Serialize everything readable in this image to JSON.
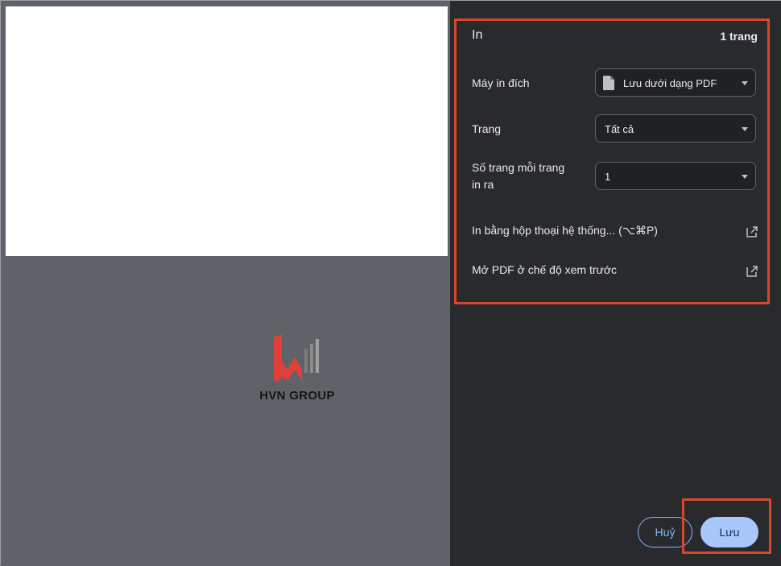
{
  "panel": {
    "title": "In",
    "page_count": "1 trang",
    "destination": {
      "label": "Máy in đích",
      "value": "Lưu dưới dạng PDF",
      "icon": "file-icon"
    },
    "pages": {
      "label": "Trang",
      "value": "Tất cả"
    },
    "pages_per_sheet": {
      "label_line1": "Số trang mỗi trang",
      "label_line2": "in ra",
      "value": "1"
    },
    "system_dialog": {
      "label": "In bằng hộp thoại hệ thống... (⌥⌘P)",
      "icon": "open-external-icon"
    },
    "open_pdf": {
      "label": "Mở PDF ở chế độ xem trước",
      "icon": "open-external-icon"
    }
  },
  "buttons": {
    "cancel": "Huỷ",
    "save": "Lưu"
  },
  "preview": {
    "logo_text": "HVN GROUP"
  },
  "colors": {
    "panel_bg": "#292a2d",
    "highlight": "#d9472b",
    "accent": "#a8c7fa",
    "logo_red": "#e0403a"
  }
}
